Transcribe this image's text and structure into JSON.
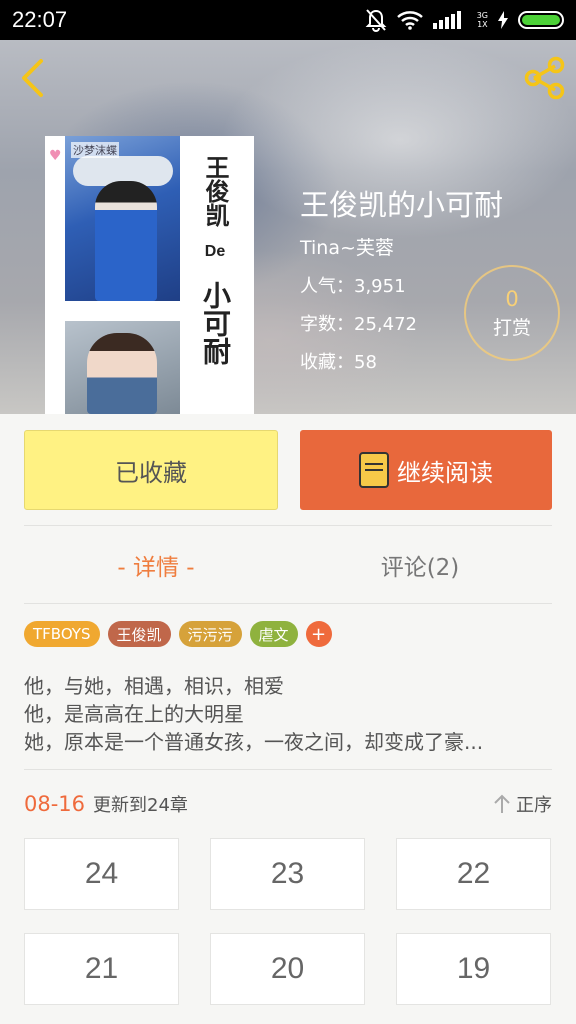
{
  "status_bar": {
    "time": "22:07",
    "network": [
      "3G",
      "1X"
    ]
  },
  "book": {
    "title": "王俊凯的小可耐",
    "author": "Tina~芙蓉",
    "popularity": "人气：3,951",
    "word_count": "字数：25,472",
    "favorites": "收藏：58",
    "cover": {
      "title_top": "王俊凯",
      "title_mid": "De",
      "title_bottom": "小可耐",
      "small_text": "沙梦沫蝶"
    }
  },
  "tip": {
    "count": "0",
    "label": "打赏"
  },
  "actions": {
    "favorite_label": "已收藏",
    "read_label": "继续阅读"
  },
  "tabs": [
    {
      "label": "- 详情 -"
    },
    {
      "label": "评论(2)"
    }
  ],
  "tags": [
    {
      "label": "TFBOYS",
      "color": "#f0a830"
    },
    {
      "label": "王俊凯",
      "color": "#c0674a"
    },
    {
      "label": "污污污",
      "color": "#d6a23a"
    },
    {
      "label": "虐文",
      "color": "#8fb23e"
    }
  ],
  "tag_more": "+",
  "description": [
    "他，与她，相遇，相识，相爱",
    "他，是高高在上的大明星",
    "她，原本是一个普通女孩，一夜之间，却变成了豪..."
  ],
  "update": {
    "date": "08-16",
    "text": "更新到24章",
    "sort_label": "正序"
  },
  "chapters": [
    "24",
    "23",
    "22",
    "21",
    "20",
    "19"
  ],
  "colors": {
    "accent": "#ef6a3c",
    "read_button": "#e8683c",
    "favorite_button": "#fff283"
  }
}
